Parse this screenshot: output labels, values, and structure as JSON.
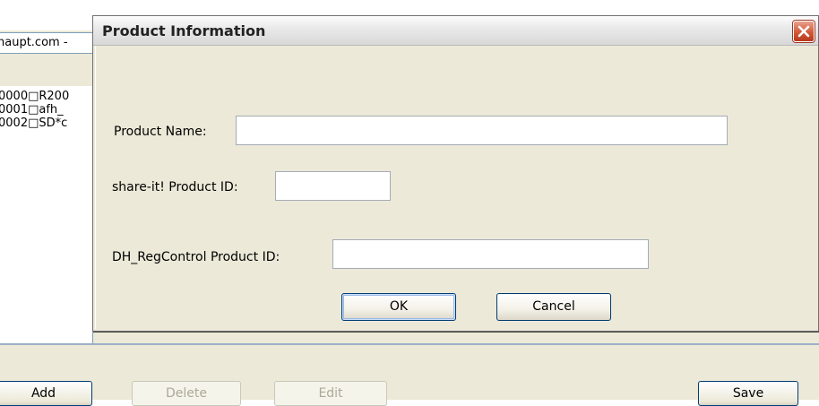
{
  "background_app": {
    "email_fragment": "naupt.com -",
    "list_rows": [
      "0000□R200",
      "0001□afh_",
      "0002□SD*c"
    ],
    "buttons": {
      "add": "Add",
      "delete": "Delete",
      "edit": "Edit",
      "save": "Save"
    },
    "disabled_buttons": [
      "Delete",
      "Edit"
    ]
  },
  "dialog": {
    "title": "Product Information",
    "close_icon": "close-icon",
    "fields": {
      "product_name": {
        "label": "Product Name:",
        "value": ""
      },
      "shareit_product_id": {
        "label": "share-it! Product ID:",
        "value": ""
      },
      "dh_regcontrol_product_id": {
        "label": "DH_RegControl Product ID:",
        "value": ""
      }
    },
    "buttons": {
      "ok": "OK",
      "cancel": "Cancel"
    }
  },
  "colors": {
    "window_background": "#ece9d8",
    "close_button": "#d1593a",
    "button_border": "#003c74",
    "input_border": "#a5acb5"
  }
}
